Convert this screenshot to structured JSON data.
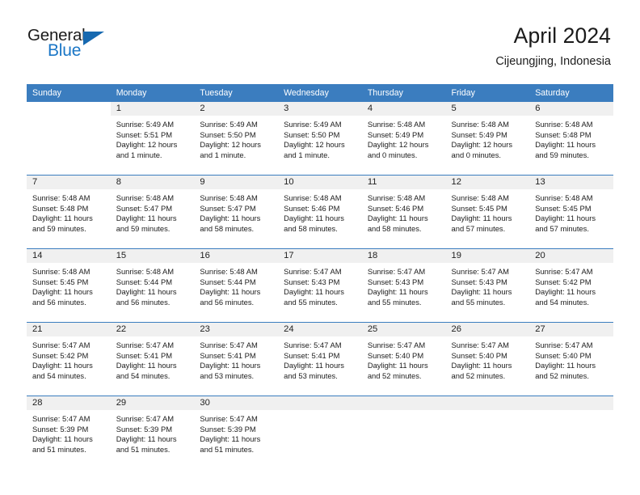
{
  "brand": {
    "name_part1": "General",
    "name_part2": "Blue",
    "triangle_color": "#1769b0",
    "blue_color": "#1a76c6"
  },
  "header": {
    "title": "April 2024",
    "subtitle": "Cijeungjing, Indonesia"
  },
  "theme": {
    "header_row_bg": "#3b7dbf",
    "daynum_band_bg": "#f0f0f0",
    "row_divider": "#3b7dbf",
    "text": "#1c1c1c"
  },
  "weekday_headers": [
    "Sunday",
    "Monday",
    "Tuesday",
    "Wednesday",
    "Thursday",
    "Friday",
    "Saturday"
  ],
  "weeks": [
    [
      {
        "day": "",
        "sunrise": "",
        "sunset": "",
        "daylight1": "",
        "daylight2": "",
        "blank": true
      },
      {
        "day": "1",
        "sunrise": "Sunrise: 5:49 AM",
        "sunset": "Sunset: 5:51 PM",
        "daylight1": "Daylight: 12 hours",
        "daylight2": "and 1 minute."
      },
      {
        "day": "2",
        "sunrise": "Sunrise: 5:49 AM",
        "sunset": "Sunset: 5:50 PM",
        "daylight1": "Daylight: 12 hours",
        "daylight2": "and 1 minute."
      },
      {
        "day": "3",
        "sunrise": "Sunrise: 5:49 AM",
        "sunset": "Sunset: 5:50 PM",
        "daylight1": "Daylight: 12 hours",
        "daylight2": "and 1 minute."
      },
      {
        "day": "4",
        "sunrise": "Sunrise: 5:48 AM",
        "sunset": "Sunset: 5:49 PM",
        "daylight1": "Daylight: 12 hours",
        "daylight2": "and 0 minutes."
      },
      {
        "day": "5",
        "sunrise": "Sunrise: 5:48 AM",
        "sunset": "Sunset: 5:49 PM",
        "daylight1": "Daylight: 12 hours",
        "daylight2": "and 0 minutes."
      },
      {
        "day": "6",
        "sunrise": "Sunrise: 5:48 AM",
        "sunset": "Sunset: 5:48 PM",
        "daylight1": "Daylight: 11 hours",
        "daylight2": "and 59 minutes."
      }
    ],
    [
      {
        "day": "7",
        "sunrise": "Sunrise: 5:48 AM",
        "sunset": "Sunset: 5:48 PM",
        "daylight1": "Daylight: 11 hours",
        "daylight2": "and 59 minutes."
      },
      {
        "day": "8",
        "sunrise": "Sunrise: 5:48 AM",
        "sunset": "Sunset: 5:47 PM",
        "daylight1": "Daylight: 11 hours",
        "daylight2": "and 59 minutes."
      },
      {
        "day": "9",
        "sunrise": "Sunrise: 5:48 AM",
        "sunset": "Sunset: 5:47 PM",
        "daylight1": "Daylight: 11 hours",
        "daylight2": "and 58 minutes."
      },
      {
        "day": "10",
        "sunrise": "Sunrise: 5:48 AM",
        "sunset": "Sunset: 5:46 PM",
        "daylight1": "Daylight: 11 hours",
        "daylight2": "and 58 minutes."
      },
      {
        "day": "11",
        "sunrise": "Sunrise: 5:48 AM",
        "sunset": "Sunset: 5:46 PM",
        "daylight1": "Daylight: 11 hours",
        "daylight2": "and 58 minutes."
      },
      {
        "day": "12",
        "sunrise": "Sunrise: 5:48 AM",
        "sunset": "Sunset: 5:45 PM",
        "daylight1": "Daylight: 11 hours",
        "daylight2": "and 57 minutes."
      },
      {
        "day": "13",
        "sunrise": "Sunrise: 5:48 AM",
        "sunset": "Sunset: 5:45 PM",
        "daylight1": "Daylight: 11 hours",
        "daylight2": "and 57 minutes."
      }
    ],
    [
      {
        "day": "14",
        "sunrise": "Sunrise: 5:48 AM",
        "sunset": "Sunset: 5:45 PM",
        "daylight1": "Daylight: 11 hours",
        "daylight2": "and 56 minutes."
      },
      {
        "day": "15",
        "sunrise": "Sunrise: 5:48 AM",
        "sunset": "Sunset: 5:44 PM",
        "daylight1": "Daylight: 11 hours",
        "daylight2": "and 56 minutes."
      },
      {
        "day": "16",
        "sunrise": "Sunrise: 5:48 AM",
        "sunset": "Sunset: 5:44 PM",
        "daylight1": "Daylight: 11 hours",
        "daylight2": "and 56 minutes."
      },
      {
        "day": "17",
        "sunrise": "Sunrise: 5:47 AM",
        "sunset": "Sunset: 5:43 PM",
        "daylight1": "Daylight: 11 hours",
        "daylight2": "and 55 minutes."
      },
      {
        "day": "18",
        "sunrise": "Sunrise: 5:47 AM",
        "sunset": "Sunset: 5:43 PM",
        "daylight1": "Daylight: 11 hours",
        "daylight2": "and 55 minutes."
      },
      {
        "day": "19",
        "sunrise": "Sunrise: 5:47 AM",
        "sunset": "Sunset: 5:43 PM",
        "daylight1": "Daylight: 11 hours",
        "daylight2": "and 55 minutes."
      },
      {
        "day": "20",
        "sunrise": "Sunrise: 5:47 AM",
        "sunset": "Sunset: 5:42 PM",
        "daylight1": "Daylight: 11 hours",
        "daylight2": "and 54 minutes."
      }
    ],
    [
      {
        "day": "21",
        "sunrise": "Sunrise: 5:47 AM",
        "sunset": "Sunset: 5:42 PM",
        "daylight1": "Daylight: 11 hours",
        "daylight2": "and 54 minutes."
      },
      {
        "day": "22",
        "sunrise": "Sunrise: 5:47 AM",
        "sunset": "Sunset: 5:41 PM",
        "daylight1": "Daylight: 11 hours",
        "daylight2": "and 54 minutes."
      },
      {
        "day": "23",
        "sunrise": "Sunrise: 5:47 AM",
        "sunset": "Sunset: 5:41 PM",
        "daylight1": "Daylight: 11 hours",
        "daylight2": "and 53 minutes."
      },
      {
        "day": "24",
        "sunrise": "Sunrise: 5:47 AM",
        "sunset": "Sunset: 5:41 PM",
        "daylight1": "Daylight: 11 hours",
        "daylight2": "and 53 minutes."
      },
      {
        "day": "25",
        "sunrise": "Sunrise: 5:47 AM",
        "sunset": "Sunset: 5:40 PM",
        "daylight1": "Daylight: 11 hours",
        "daylight2": "and 52 minutes."
      },
      {
        "day": "26",
        "sunrise": "Sunrise: 5:47 AM",
        "sunset": "Sunset: 5:40 PM",
        "daylight1": "Daylight: 11 hours",
        "daylight2": "and 52 minutes."
      },
      {
        "day": "27",
        "sunrise": "Sunrise: 5:47 AM",
        "sunset": "Sunset: 5:40 PM",
        "daylight1": "Daylight: 11 hours",
        "daylight2": "and 52 minutes."
      }
    ],
    [
      {
        "day": "28",
        "sunrise": "Sunrise: 5:47 AM",
        "sunset": "Sunset: 5:39 PM",
        "daylight1": "Daylight: 11 hours",
        "daylight2": "and 51 minutes."
      },
      {
        "day": "29",
        "sunrise": "Sunrise: 5:47 AM",
        "sunset": "Sunset: 5:39 PM",
        "daylight1": "Daylight: 11 hours",
        "daylight2": "and 51 minutes."
      },
      {
        "day": "30",
        "sunrise": "Sunrise: 5:47 AM",
        "sunset": "Sunset: 5:39 PM",
        "daylight1": "Daylight: 11 hours",
        "daylight2": "and 51 minutes."
      },
      {
        "day": "",
        "sunrise": "",
        "sunset": "",
        "daylight1": "",
        "daylight2": "",
        "empty": true
      },
      {
        "day": "",
        "sunrise": "",
        "sunset": "",
        "daylight1": "",
        "daylight2": "",
        "empty": true
      },
      {
        "day": "",
        "sunrise": "",
        "sunset": "",
        "daylight1": "",
        "daylight2": "",
        "empty": true
      },
      {
        "day": "",
        "sunrise": "",
        "sunset": "",
        "daylight1": "",
        "daylight2": "",
        "empty": true
      }
    ]
  ]
}
